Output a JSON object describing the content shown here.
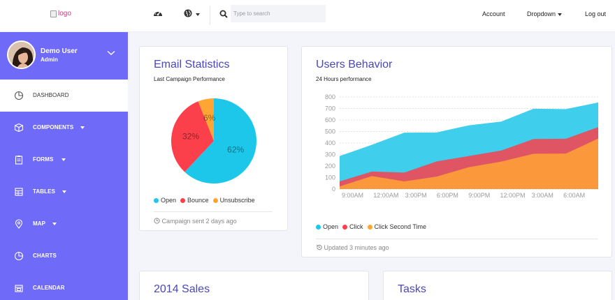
{
  "topbar": {
    "logo_alt": "logo",
    "search_placeholder": "Type to search",
    "nav": {
      "account": "Account",
      "dropdown": "Dropdown",
      "logout": "Log out"
    }
  },
  "sidebar": {
    "user": {
      "name": "Demo User",
      "role": "Admin"
    },
    "items": [
      {
        "label": "DASHBOARD",
        "icon": "pie-chart-icon"
      },
      {
        "label": "COMPONENTS",
        "icon": "cube-icon"
      },
      {
        "label": "FORMS",
        "icon": "clipboard-icon"
      },
      {
        "label": "TABLES",
        "icon": "table-icon"
      },
      {
        "label": "MAP",
        "icon": "map-pin-icon"
      },
      {
        "label": "CHARTS",
        "icon": "pie-chart-icon"
      },
      {
        "label": "CALENDAR",
        "icon": "calendar-icon"
      }
    ],
    "colors": {
      "background": "#6f6af8",
      "active_bg": "#ffffff"
    }
  },
  "email_stats": {
    "title": "Email Statistics",
    "subtitle": "Last Campaign Performance",
    "legend": [
      "Open",
      "Bounce",
      "Unsubscribe"
    ],
    "footnote": "Campaign sent 2 days ago"
  },
  "users_behavior": {
    "title": "Users Behavior",
    "subtitle": "24 Hours performance",
    "legend": [
      "Open",
      "Click",
      "Click Second Time"
    ],
    "footnote": "Updated 3 minutes ago"
  },
  "sales": {
    "title": "2014 Sales"
  },
  "tasks": {
    "title": "Tasks"
  },
  "chart_data": [
    {
      "type": "pie",
      "categories": [
        "Open",
        "Bounce",
        "Unsubscribe"
      ],
      "values": [
        62,
        32,
        6
      ],
      "labels": [
        "62%",
        "32%",
        "6%"
      ],
      "colors": [
        "#1dc7ea",
        "#fb404b",
        "#ffa534"
      ]
    },
    {
      "type": "area",
      "x": [
        "9:00AM",
        "12:00AM",
        "3:00PM",
        "6:00PM",
        "9:00PM",
        "12:00PM",
        "3:00AM",
        "6:00AM"
      ],
      "ylim": [
        0,
        800
      ],
      "yticks": [
        0,
        100,
        200,
        300,
        400,
        500,
        600,
        700,
        800
      ],
      "grid": true,
      "colors": [
        "#1dc7ea",
        "#fb404b",
        "#ffa534"
      ],
      "series": [
        {
          "name": "Open",
          "values": [
            287,
            385,
            490,
            492,
            554,
            586,
            698,
            695,
            752
          ]
        },
        {
          "name": "Click",
          "values": [
            67,
            152,
            143,
            240,
            287,
            335,
            435,
            437,
            539
          ]
        },
        {
          "name": "Click Second Time",
          "values": [
            23,
            113,
            67,
            108,
            190,
            239,
            307,
            308,
            439
          ]
        }
      ]
    }
  ]
}
